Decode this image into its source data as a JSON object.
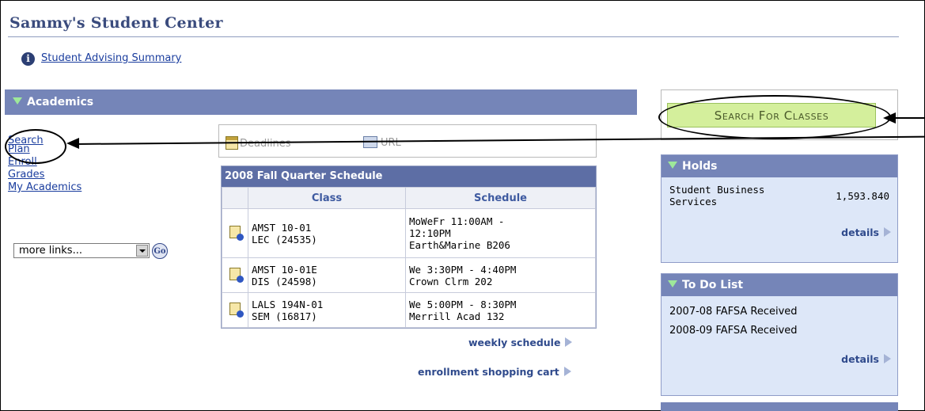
{
  "page": {
    "title": "Sammy's Student Center"
  },
  "advising": {
    "link": "Student Advising Summary"
  },
  "academics": {
    "header": "Academics",
    "links": [
      "Search",
      "Plan",
      "Enroll",
      "Grades",
      "My Academics"
    ],
    "more_links": {
      "selected": "more links..."
    },
    "go_label": "Go"
  },
  "tabs": {
    "deadlines": "Deadlines",
    "url": "URL"
  },
  "schedule": {
    "title": "2008 Fall Quarter Schedule",
    "columns": [
      "Class",
      "Schedule"
    ],
    "rows": [
      {
        "class_line1": "AMST 10-01",
        "class_line2": "LEC (24535)",
        "sched_line1": "MoWeFr 11:00AM -",
        "sched_line2": "12:10PM",
        "sched_line3": "Earth&Marine B206"
      },
      {
        "class_line1": "AMST 10-01E",
        "class_line2": "DIS (24598)",
        "sched_line1": "We 3:30PM - 4:40PM",
        "sched_line2": "Crown Clrm 202",
        "sched_line3": ""
      },
      {
        "class_line1": "LALS 194N-01",
        "class_line2": "SEM (16817)",
        "sched_line1": "We 5:00PM - 8:30PM",
        "sched_line2": "Merrill Acad 132",
        "sched_line3": ""
      }
    ],
    "weekly_link": "weekly schedule",
    "cart_link": "enrollment shopping cart"
  },
  "search_button": {
    "label": "Search For Classes"
  },
  "holds": {
    "header": "Holds",
    "item_label_1": "Student Business",
    "item_label_2": "Services",
    "item_amount": "1,593.840",
    "details": "details"
  },
  "todo": {
    "header": "To Do List",
    "items": [
      "2007-08 FAFSA Received",
      "2008-09 FAFSA Received"
    ],
    "details": "details"
  },
  "colors": {
    "section_bar": "#7585b8",
    "title": "#3a4b7d",
    "button_bg": "#d4ef9c",
    "panel_bg": "#dde7f8"
  }
}
